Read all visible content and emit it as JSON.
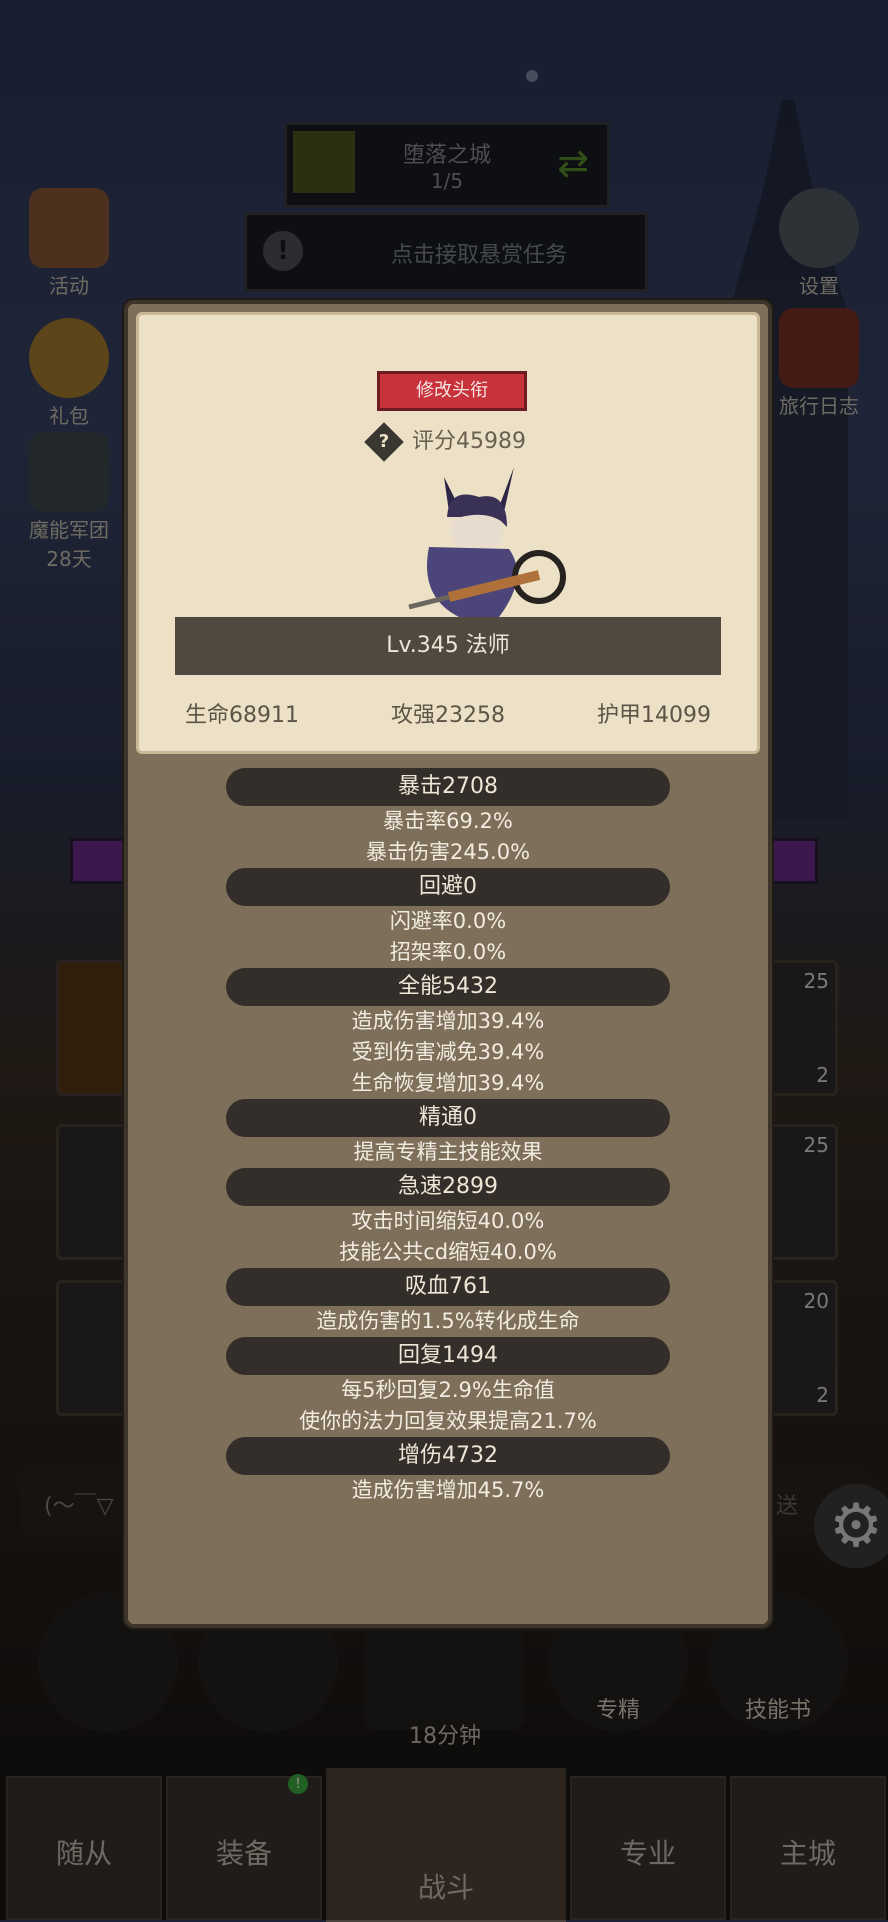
{
  "stage": {
    "name": "堕落之城",
    "progress": "1/5"
  },
  "bounty": {
    "text": "点击接取悬赏任务"
  },
  "left_buttons": [
    {
      "label": "活动"
    },
    {
      "label": "礼包"
    },
    {
      "label": "魔能军团",
      "sub": "28天"
    }
  ],
  "right_buttons": [
    {
      "label": "设置"
    },
    {
      "label": "旅行日志"
    }
  ],
  "profile": {
    "title_button": "修改头衔",
    "score": "评分45989",
    "level_class": "Lv.345 法师",
    "hp": "生命68911",
    "atk": "攻强23258",
    "armor": "护甲14099"
  },
  "stats": [
    {
      "name": "暴击2708",
      "lines": [
        "暴击率69.2%",
        "暴击伤害245.0%"
      ]
    },
    {
      "name": "回避0",
      "lines": [
        "闪避率0.0%",
        "招架率0.0%"
      ]
    },
    {
      "name": "全能5432",
      "lines": [
        "造成伤害增加39.4%",
        "受到伤害减免39.4%",
        "生命恢复增加39.4%"
      ]
    },
    {
      "name": "精通0",
      "lines": [
        "提高专精主技能效果"
      ]
    },
    {
      "name": "急速2899",
      "lines": [
        "攻击时间缩短40.0%",
        "技能公共cd缩短40.0%"
      ]
    },
    {
      "name": "吸血761",
      "lines": [
        "造成伤害的1.5%转化成生命"
      ]
    },
    {
      "name": "回复1494",
      "lines": [
        "每5秒回复2.9%生命值",
        "使你的法力回复效果提高21.7%"
      ]
    },
    {
      "name": "增伤4732",
      "lines": [
        "造成伤害增加45.7%"
      ]
    }
  ],
  "cards": {
    "c1": "25",
    "c2": "2",
    "c3": "25",
    "c4": "20",
    "c5": "2"
  },
  "chat": {
    "face": "(～￣▽",
    "send": "送"
  },
  "actions": {
    "timer": "18分钟",
    "spec": "专精",
    "skillbook": "技能书"
  },
  "nav": [
    "随从",
    "装备",
    "战斗",
    "专业",
    "主城"
  ],
  "colors": {
    "title_button": "#c8333b",
    "parchment": "#ece1c6",
    "pill": "#332e29",
    "modal": "#7e6f5b"
  }
}
